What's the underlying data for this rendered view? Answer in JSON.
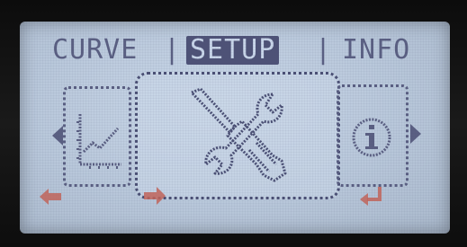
{
  "tabs": {
    "curve": "CURVE",
    "separator": "|",
    "setup": "SETUP",
    "info": "INFO",
    "selected": "SETUP"
  },
  "carousel": {
    "left_item": "chart-icon",
    "center_item": "tools-icon",
    "right_item": "info-icon"
  },
  "softkeys": [
    "arrow-left-icon",
    "arrow-right-icon",
    "enter-icon"
  ],
  "colors": {
    "lcd_background": "#c2d0e2",
    "pixel_ink": "#5a5f82",
    "softkey_red": "#c0645a",
    "bezel": "#101010"
  }
}
